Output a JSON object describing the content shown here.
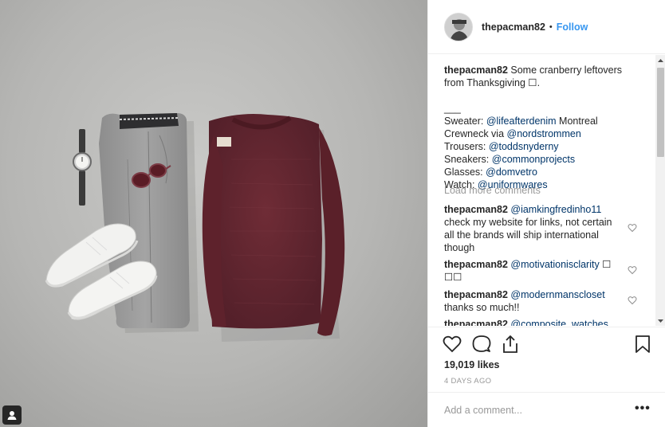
{
  "post": {
    "username": "thepacman82",
    "dot": "•",
    "follow_label": "Follow"
  },
  "caption": {
    "username": "thepacman82",
    "line1": "Some cranberry leftovers from Thanksgiving ☐.",
    "divider": "___",
    "sweater_label": "Sweater:",
    "sweater_mention": "@lifeafterdenim",
    "sweater_rest": "Montreal Crewneck via",
    "sweater_mention2": "@nordstrommen",
    "trousers_label": "Trousers:",
    "trousers_mention": "@toddsnyderny",
    "sneakers_label": "Sneakers:",
    "sneakers_mention": "@commonprojects",
    "glasses_label": "Glasses:",
    "glasses_mention": "@domvetro",
    "watch_label": "Watch:",
    "watch_mention": "@uniformwares"
  },
  "load_more": "Load more comments",
  "comments": [
    {
      "username": "thepacman82",
      "mention": "@iamkingfredinho11",
      "text": "check my website for links, not certain all the brands will ship international though"
    },
    {
      "username": "thepacman82",
      "mention": "@motivationisclarity",
      "text": "☐ ☐☐"
    },
    {
      "username": "thepacman82",
      "mention": "@modernmanscloset",
      "text": "thanks so much!!"
    },
    {
      "username": "thepacman82",
      "mention": "@composite_watches",
      "text": ""
    }
  ],
  "likes": "19,019 likes",
  "date": "4 DAYS AGO",
  "add_comment": {
    "placeholder": "Add a comment..."
  },
  "more_label": "•••",
  "icons": [
    "user-tag-icon",
    "heart-icon",
    "comment-icon",
    "share-icon",
    "bookmark-icon",
    "more-options-icon"
  ],
  "colors": {
    "follow": "#3897f0",
    "mention": "#003569",
    "muted": "#999999",
    "sweater": "#6b2a33"
  }
}
